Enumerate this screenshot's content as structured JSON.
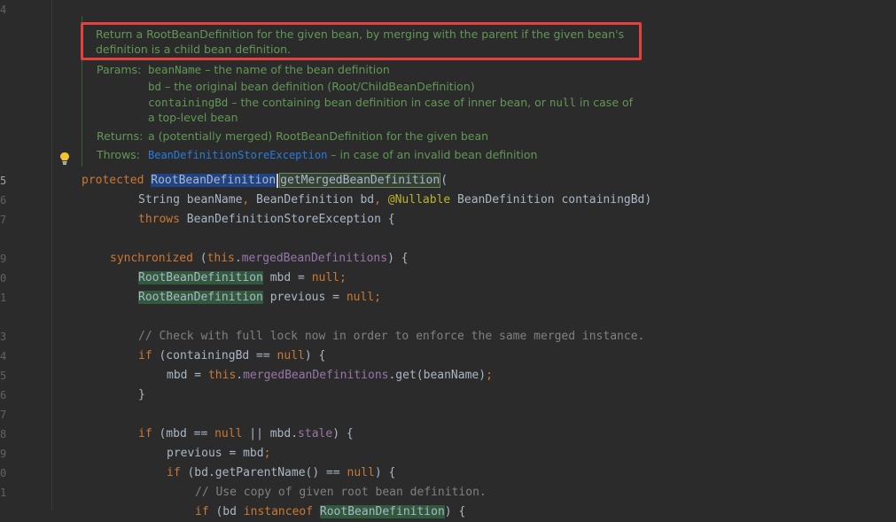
{
  "gutter": {
    "line_numbers": [
      "4",
      "5",
      "6",
      "7",
      "9",
      "0",
      "1",
      "3",
      "4",
      "5",
      "6",
      "7",
      "8",
      "9",
      "0",
      "1"
    ],
    "current_line": "5"
  },
  "javadoc": {
    "summary_line1": "Return a RootBeanDefinition for the given bean, by merging with the parent if the given bean's",
    "summary_line2": "definition is a child bean definition.",
    "params_label": "Params:",
    "param1_name": "beanName",
    "param1_desc": " – the name of the bean definition",
    "param2_name": "bd",
    "param2_desc": " – the original bean definition (Root/ChildBeanDefinition)",
    "param3_name": "containingBd",
    "param3_desc_a": " – the containing bean definition in case of inner bean, or ",
    "param3_null": "null",
    "param3_desc_b": " in case of",
    "param3_desc_c": "a top-level bean",
    "returns_label": "Returns:",
    "returns_desc": "a (potentially merged) RootBeanDefinition for the given bean",
    "throws_label": "Throws:",
    "throws_link": "BeanDefinitionStoreException",
    "throws_desc": " – in case of an invalid bean definition"
  },
  "code": {
    "l1_protected": "protected",
    "l1_type": "RootBeanDefinition",
    "l1_method": "getMergedBeanDefinition",
    "l1_paren": "(",
    "l2_a": "String beanName",
    "l2_comma1": ",",
    "l2_b": " BeanDefinition bd",
    "l2_comma2": ",",
    "l2_ann": " @Nullable",
    "l2_c": " BeanDefinition containingBd)",
    "l3_throws": "throws",
    "l3_rest": " BeanDefinitionStoreException {",
    "l4_sync": "synchronized",
    "l4_a": " (",
    "l4_this": "this",
    "l4_dot": ".",
    "l4_field": "mergedBeanDefinitions",
    "l4_b": ") {",
    "l5_type": "RootBeanDefinition",
    "l5_a": " mbd = ",
    "l5_null": "null",
    "l5_semi": ";",
    "l6_type": "RootBeanDefinition",
    "l6_a": " previous = ",
    "l6_null": "null",
    "l6_semi": ";",
    "l7_comment": "// Check with full lock now in order to enforce the same merged instance.",
    "l8_if": "if",
    "l8_a": " (containingBd == ",
    "l8_null": "null",
    "l8_b": ") {",
    "l9_a": "mbd = ",
    "l9_this": "this",
    "l9_dot": ".",
    "l9_field": "mergedBeanDefinitions",
    "l9_b": ".get(beanName)",
    "l9_semi": ";",
    "l10": "}",
    "l11_if": "if",
    "l11_a": " (mbd == ",
    "l11_null": "null",
    "l11_b": " || mbd.",
    "l11_field": "stale",
    "l11_c": ") {",
    "l12_a": "previous = mbd",
    "l12_semi": ";",
    "l13_if": "if",
    "l13_a": " (bd.getParentName() == ",
    "l13_null": "null",
    "l13_b": ") {",
    "l14_comment": "// Use copy of given root bean definition.",
    "l15_if": "if",
    "l15_a": " (bd ",
    "l15_kw": "instanceof",
    "l15_type": "RootBeanDefinition",
    "l15_b": ") {"
  }
}
